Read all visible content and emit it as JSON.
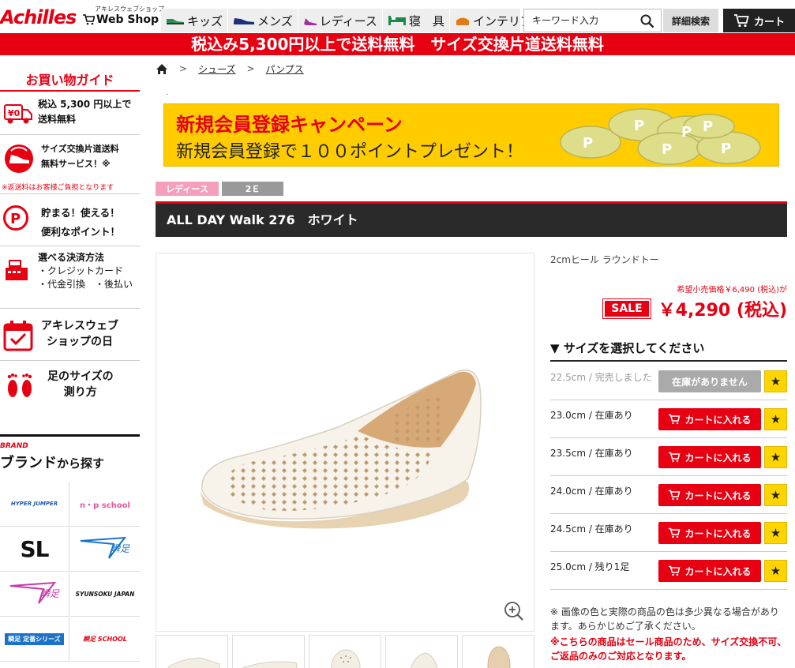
{
  "header": {
    "logo_text": "Achilles",
    "webshop_sub": "アキレスウェブショップ",
    "webshop_main": "Web Shop",
    "categories": [
      {
        "label": "キッズ",
        "icon": "kids-shoe-icon"
      },
      {
        "label": "メンズ",
        "icon": "mens-shoe-icon"
      },
      {
        "label": "レディース",
        "icon": "heel-icon"
      },
      {
        "label": "寝　具",
        "icon": "bed-icon"
      },
      {
        "label": "インテリア",
        "icon": "interior-icon"
      }
    ],
    "search_placeholder": "キーワード入力",
    "advanced_search": "詳細検索",
    "cart": "カート"
  },
  "banner": "税込み5,300円以上で送料無料　サイズ交換片道送料無料",
  "sidebar": {
    "guide_title": "お買い物ガイド",
    "free_shipping": [
      "税込 5,300 円以上で",
      "送料無料"
    ],
    "exchange": [
      "サイズ交換片道送料",
      "無料サービス！※"
    ],
    "exchange_note": "※返送料はお客様ご負担となります",
    "points": [
      "貯まる！使える！",
      "便利なポイント！"
    ],
    "payment": [
      "選べる決済方法",
      "・クレジットカード",
      "・代金引換　・後払い"
    ],
    "shop_day": [
      "アキレスウェブ",
      "ショップの日"
    ],
    "foot_size": [
      "足のサイズの",
      "測り方"
    ],
    "brand_en": "BRAND",
    "brand_jp": "ブランド",
    "brand_jp_suffix": "から探す",
    "brands": [
      "HYPER JUMPER",
      "n・p school",
      "SL",
      "瞬足",
      "瞬足",
      "SYUNSOKU JAPAN",
      "瞬足 定番シリーズ",
      "瞬足 SCHOOL"
    ]
  },
  "breadcrumb": {
    "shoes": "シューズ",
    "pumps": "パンプス"
  },
  "campaign": {
    "line1": "新規会員登録キャンペーン",
    "line2": "新規会員登録で１００ポイントプレゼント！"
  },
  "tags": [
    "レディース",
    "2Ｅ"
  ],
  "product": {
    "title": "ALL DAY Walk 276　ホワイト",
    "feature": "2cmヒール ラウンドトー",
    "msrp": "希望小売価格￥6,490 (税込)が",
    "sale_label": "SALE",
    "price": "￥4,290 (税込)"
  },
  "sizes": {
    "title": "▼ サイズを選択してください",
    "rows": [
      {
        "label": "22.5cm / 完売しました",
        "button": "在庫がありません",
        "sold_out": true
      },
      {
        "label": "23.0cm / 在庫あり",
        "button": "カートに入れる",
        "sold_out": false
      },
      {
        "label": "23.5cm / 在庫あり",
        "button": "カートに入れる",
        "sold_out": false
      },
      {
        "label": "24.0cm / 在庫あり",
        "button": "カートに入れる",
        "sold_out": false
      },
      {
        "label": "24.5cm / 在庫あり",
        "button": "カートに入れる",
        "sold_out": false
      },
      {
        "label": "25.0cm / 残り1足",
        "button": "カートに入れる",
        "sold_out": false
      }
    ]
  },
  "notes": {
    "color": "※ 画像の色と実際の商品の色は多少異なる場合があります。あらかじめご了承ください。",
    "sale": "※こちらの商品はセール商品のため、サイズ交換不可、ご返品のみのご対応となります。"
  },
  "colors": {
    "accent": "#e60012",
    "dark": "#2a2a2a",
    "campaign_bg": "#ffcc00",
    "fav": "#ffd400"
  }
}
